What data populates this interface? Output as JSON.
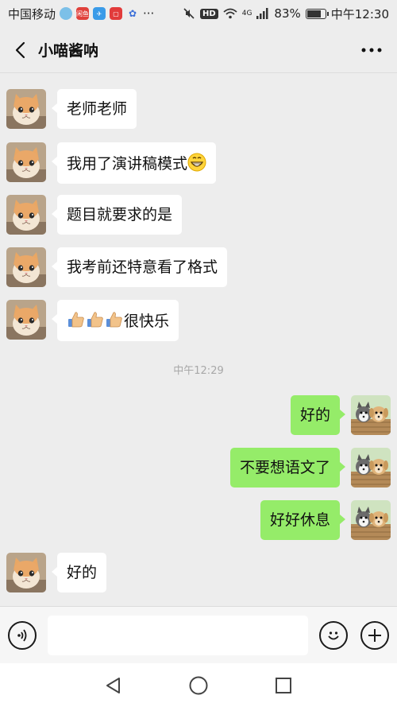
{
  "status_bar": {
    "carrier": "中国移动",
    "battery": "83%",
    "time": "中午12:30",
    "hd": "HD",
    "network": "4G",
    "app_badge": "闲鱼"
  },
  "chat": {
    "title": "小喵酱呐"
  },
  "messages": [
    {
      "side": "left",
      "text": "老师老师"
    },
    {
      "side": "left",
      "text": "我用了演讲稿模式",
      "trailing_emoji": "grinning-face"
    },
    {
      "side": "left",
      "text": "题目就要求的是"
    },
    {
      "side": "left",
      "text": "我考前还特意看了格式"
    },
    {
      "side": "left",
      "text": "很快乐",
      "leading_emoji": "thumbs-up x3"
    },
    {
      "side": "right",
      "text": "好的"
    },
    {
      "side": "right",
      "text": "不要想语文了"
    },
    {
      "side": "right",
      "text": "好好休息"
    },
    {
      "side": "left",
      "text": "好的"
    }
  ],
  "timestamp": "中午12:29",
  "colors": {
    "background": "#ededed",
    "bubble_left": "#ffffff",
    "bubble_right": "#95ec69",
    "timestamp": "#a8a8a8"
  },
  "icons": {
    "back": "chevron-left-icon",
    "more": "more-dots-icon",
    "voice": "voice-icon",
    "emoji": "emoji-icon",
    "add": "plus-icon",
    "nav_back": "triangle-back-icon",
    "nav_home": "circle-home-icon",
    "nav_recent": "square-recent-icon"
  }
}
